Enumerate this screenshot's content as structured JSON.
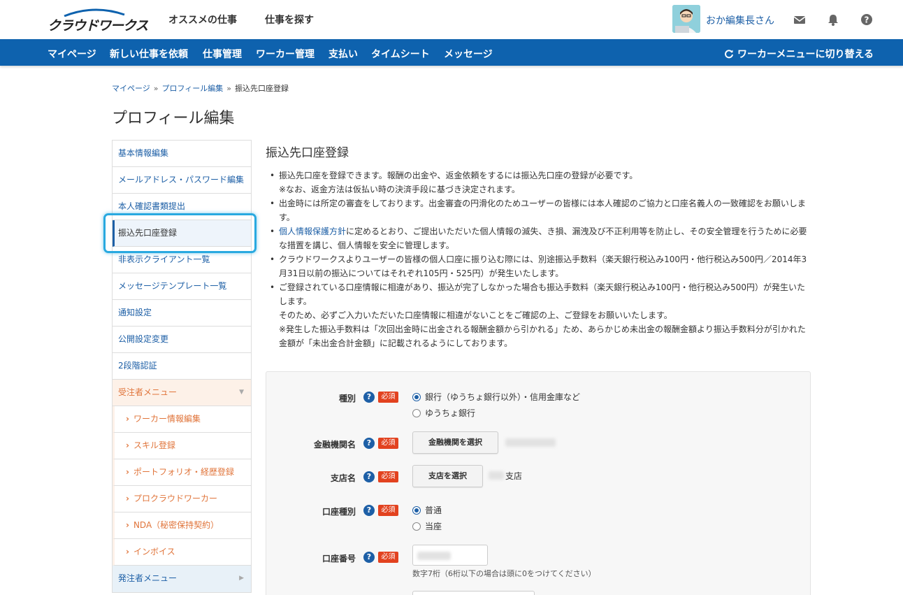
{
  "header": {
    "logo_text": "クラウドワークス",
    "nav": [
      "オススメの仕事",
      "仕事を探す"
    ],
    "username": "おか編集長さん",
    "icons": [
      "mail-icon",
      "bell-icon",
      "help-icon"
    ]
  },
  "bluenav": {
    "items": [
      "マイページ",
      "新しい仕事を依頼",
      "仕事管理",
      "ワーカー管理",
      "支払い",
      "タイムシート",
      "メッセージ"
    ],
    "switch_label": "ワーカーメニューに切り替える"
  },
  "breadcrumb": [
    "マイページ",
    "プロフィール編集",
    "振込先口座登録"
  ],
  "page_title": "プロフィール編集",
  "sidebar": {
    "items": [
      "基本情報編集",
      "メールアドレス・パスワード編集",
      "本人確認書類提出",
      "振込先口座登録",
      "非表示クライアント一覧",
      "メッセージテンプレート一覧",
      "通知設定",
      "公開設定変更",
      "2段階認証"
    ],
    "group1": "受注者メニュー",
    "sub_items": [
      "ワーカー情報編集",
      "スキル登録",
      "ポートフォリオ・経歴登録",
      "プロクラウドワーカー",
      "NDA（秘密保持契約）",
      "インボイス"
    ],
    "group2": "発注者メニュー"
  },
  "main": {
    "title": "振込先口座登録",
    "notes": [
      "振込先口座を登録できます。報酬の出金や、返金依頼をするには振込先口座の登録が必要です。",
      "※なお、返金方法は仮払い時の決済手段に基づき決定されます。",
      "出金時には所定の審査をしております。出金審査の円滑化のためユーザーの皆様には本人確認のご協力と口座名義人の一致確認をお願いしま",
      "す。",
      "個人情報保護方針",
      "に定めるとおり、ご提出いただいた個人情報の滅失、き損、漏洩及び不正利用等を防止し、その安全管理を行うために必要",
      "な措置を講じ、個人情報を安全に管理します。",
      "クラウドワークスよりユーザーの皆様の個人口座に振り込む際には、別途振込手数料（楽天銀行税込み100円・他行税込み500円／2014年3",
      "月31日以前の振込についてはそれぞれ105円・525円）が発生いたします。",
      "ご登録されている口座情報に相違があり、振込が完了しなかった場合も振込手数料（楽天銀行税込み100円・他行税込み500円）が発生いた",
      "します。",
      "そのため、必ずご入力いただいた口座情報に相違がないことをご確認の上、ご登録をお願いいたします。",
      "※発生した振込手数料は「次回出金時に出金される報酬金額から引かれる」ため、あらかじめ未出金の報酬金額より振込手数料分が引かれた",
      "金額が「未出金合計金額」に記載されるようにしております。"
    ]
  },
  "form": {
    "required": "必須",
    "q": "?",
    "type_label": "種別",
    "type_options": [
      "銀行（ゆうちょ銀行以外）・信用金庫など",
      "ゆうちょ銀行"
    ],
    "bank_label": "金融機関名",
    "bank_button": "金融機関を選択",
    "branch_label": "支店名",
    "branch_button": "支店を選択",
    "branch_suffix": "支店",
    "account_type_label": "口座種別",
    "account_type_options": [
      "普通",
      "当座"
    ],
    "account_number_label": "口座番号",
    "account_number_hint": "数字7桁（6桁以下の場合は頭に0をつけてください）"
  }
}
